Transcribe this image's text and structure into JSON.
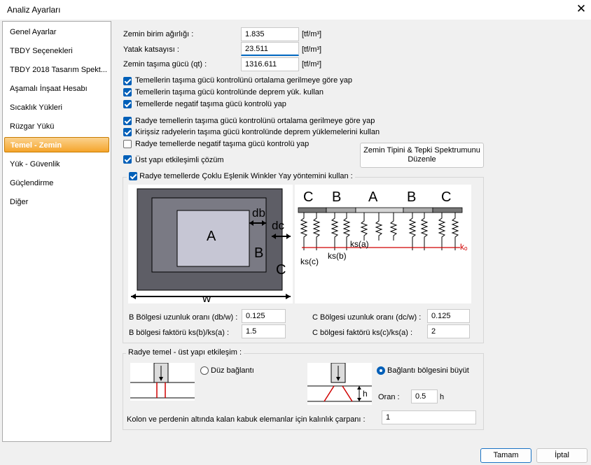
{
  "window": {
    "title": "Analiz Ayarları"
  },
  "sidebar": {
    "items": [
      {
        "label": "Genel Ayarlar"
      },
      {
        "label": "TBDY Seçenekleri"
      },
      {
        "label": "TBDY 2018 Tasarım Spekt..."
      },
      {
        "label": "Aşamalı İnşaat Hesabı"
      },
      {
        "label": "Sıcaklık Yükleri"
      },
      {
        "label": "Rüzgar Yükü"
      },
      {
        "label": "Temel - Zemin"
      },
      {
        "label": "Yük - Güvenlik"
      },
      {
        "label": "Güçlendirme"
      },
      {
        "label": "Diğer"
      }
    ],
    "selected": "Temel - Zemin"
  },
  "fields": {
    "unit_weight": {
      "label": "Zemin birim ağırlığı :",
      "value": "1.835",
      "unit": "[tf/m³]"
    },
    "subgrade": {
      "label": "Yatak katsayısı :",
      "value": "23.511",
      "unit": "[tf/m³]"
    },
    "bearing": {
      "label": "Zemin taşıma gücü (qt) :",
      "value": "1316.611",
      "unit": "[tf/m²]"
    }
  },
  "checks": [
    {
      "label": "Temellerin taşıma gücü kontrolünü ortalama gerilmeye göre yap",
      "checked": true
    },
    {
      "label": "Temellerin taşıma gücü kontrolünde deprem yük. kullan",
      "checked": true
    },
    {
      "label": "Temellerde negatif taşıma gücü kontrolü yap",
      "checked": true
    },
    {
      "label": "Radye temellerin taşıma gücü kontrolünü ortalama gerilmeye göre yap",
      "checked": true
    },
    {
      "label": "Kirişsiz radyelerin taşıma gücü kontrolünde deprem yüklemelerini kullan",
      "checked": true
    },
    {
      "label": "Radye temellerde negatif taşıma gücü kontrolü yap",
      "checked": false
    },
    {
      "label": "Üst yapı etkileşimli çözüm",
      "checked": true
    }
  ],
  "spectrum_button": {
    "line1": "Zemin Tipini  & Tepki Spektrumunu",
    "line2": "Düzenle"
  },
  "winkler": {
    "label": "Radye temellerde Çoklu Eşlenik Winkler Yay yöntemini kullan :",
    "checked": true,
    "diagram_left": {
      "a": "A",
      "b": "B",
      "c": "C",
      "db": "db",
      "dc": "dc",
      "w": "w"
    },
    "diagram_right": {
      "zones": [
        "C",
        "B",
        "A",
        "B",
        "C"
      ],
      "ksa": "ks(a)",
      "ksb": "ks(b)",
      "ksc": "ks(c)",
      "ko": "kₒ"
    },
    "b_ratio": {
      "label": "B Bölgesi uzunluk oranı (db/w) :",
      "value": "0.125"
    },
    "c_ratio": {
      "label": "C Bölgesi uzunluk oranı (dc/w) :",
      "value": "0.125"
    },
    "b_factor": {
      "label": "B bölgesi faktörü ks(b)/ks(a) :",
      "value": "1.5"
    },
    "c_factor": {
      "label": "C bölgesi faktörü ks(c)/ks(a) :",
      "value": "2"
    }
  },
  "interaction": {
    "legend": "Radye temel - üst yapı etkileşim :",
    "option1": {
      "label": "Düz bağlantı",
      "selected": false
    },
    "option2": {
      "label": "Bağlantı bölgesini büyüt",
      "selected": true
    },
    "h_label": "h",
    "ratio": {
      "label": "Oran :",
      "value": "0.5",
      "unit": "h"
    },
    "thickness": {
      "label": "Kolon ve perdenin altında kalan kabuk elemanlar için kalınlık çarpanı :",
      "value": "1"
    }
  },
  "buttons": {
    "ok": "Tamam",
    "cancel": "İptal"
  }
}
